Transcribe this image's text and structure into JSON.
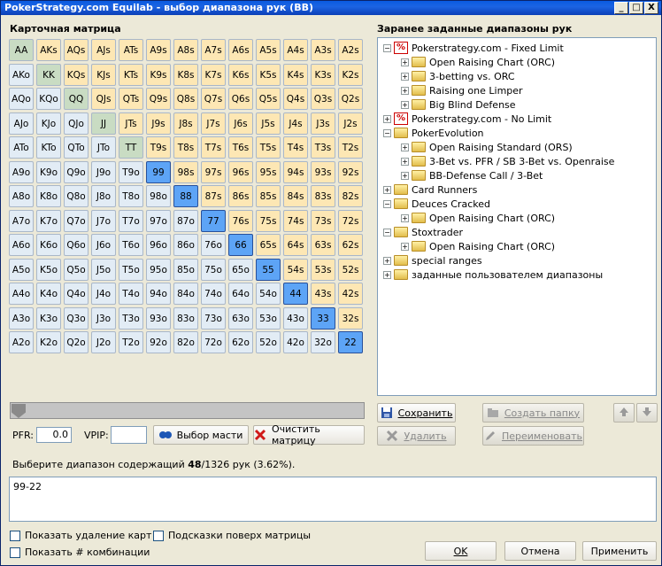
{
  "window": {
    "title": "PokerStrategy.com Equilab - выбор диапазона рук (BB)",
    "minimize": "_",
    "maximize": "□",
    "close": "X"
  },
  "matrix": {
    "title": "Карточная матрица",
    "rows": [
      [
        "AA",
        "AKs",
        "AQs",
        "AJs",
        "ATs",
        "A9s",
        "A8s",
        "A7s",
        "A6s",
        "A5s",
        "A4s",
        "A3s",
        "A2s"
      ],
      [
        "AKo",
        "KK",
        "KQs",
        "KJs",
        "KTs",
        "K9s",
        "K8s",
        "K7s",
        "K6s",
        "K5s",
        "K4s",
        "K3s",
        "K2s"
      ],
      [
        "AQo",
        "KQo",
        "QQ",
        "QJs",
        "QTs",
        "Q9s",
        "Q8s",
        "Q7s",
        "Q6s",
        "Q5s",
        "Q4s",
        "Q3s",
        "Q2s"
      ],
      [
        "AJo",
        "KJo",
        "QJo",
        "JJ",
        "JTs",
        "J9s",
        "J8s",
        "J7s",
        "J6s",
        "J5s",
        "J4s",
        "J3s",
        "J2s"
      ],
      [
        "ATo",
        "KTo",
        "QTo",
        "JTo",
        "TT",
        "T9s",
        "T8s",
        "T7s",
        "T6s",
        "T5s",
        "T4s",
        "T3s",
        "T2s"
      ],
      [
        "A9o",
        "K9o",
        "Q9o",
        "J9o",
        "T9o",
        "99",
        "98s",
        "97s",
        "96s",
        "95s",
        "94s",
        "93s",
        "92s"
      ],
      [
        "A8o",
        "K8o",
        "Q8o",
        "J8o",
        "T8o",
        "98o",
        "88",
        "87s",
        "86s",
        "85s",
        "84s",
        "83s",
        "82s"
      ],
      [
        "A7o",
        "K7o",
        "Q7o",
        "J7o",
        "T7o",
        "97o",
        "87o",
        "77",
        "76s",
        "75s",
        "74s",
        "73s",
        "72s"
      ],
      [
        "A6o",
        "K6o",
        "Q6o",
        "J6o",
        "T6o",
        "96o",
        "86o",
        "76o",
        "66",
        "65s",
        "64s",
        "63s",
        "62s"
      ],
      [
        "A5o",
        "K5o",
        "Q5o",
        "J5o",
        "T5o",
        "95o",
        "85o",
        "75o",
        "65o",
        "55",
        "54s",
        "53s",
        "52s"
      ],
      [
        "A4o",
        "K4o",
        "Q4o",
        "J4o",
        "T4o",
        "94o",
        "84o",
        "74o",
        "64o",
        "54o",
        "44",
        "43s",
        "42s"
      ],
      [
        "A3o",
        "K3o",
        "Q3o",
        "J3o",
        "T3o",
        "93o",
        "83o",
        "73o",
        "63o",
        "53o",
        "43o",
        "33",
        "32s"
      ],
      [
        "A2o",
        "K2o",
        "Q2o",
        "J2o",
        "T2o",
        "92o",
        "82o",
        "72o",
        "62o",
        "52o",
        "42o",
        "32o",
        "22"
      ]
    ],
    "selected": [
      "99",
      "88",
      "77",
      "66",
      "55",
      "44",
      "33",
      "22"
    ]
  },
  "controls": {
    "slider_value": 0,
    "pfr_label": "PFR:",
    "pfr_value": "0.0",
    "vpip_label": "VPIP:",
    "vpip_value": "",
    "suits_button": "Выбор масти",
    "clear_button": "Очистить матрицу"
  },
  "ranges": {
    "title": "Заранее заданные диапазоны рук",
    "tree": [
      {
        "level": 0,
        "expander": "−",
        "icon": "pct",
        "label": "Pokerstrategy.com - Fixed Limit"
      },
      {
        "level": 1,
        "expander": "+",
        "icon": "folder",
        "label": "Open Raising Chart (ORC)"
      },
      {
        "level": 1,
        "expander": "+",
        "icon": "folder",
        "label": "3-betting vs. ORC"
      },
      {
        "level": 1,
        "expander": "+",
        "icon": "folder",
        "label": "Raising one Limper"
      },
      {
        "level": 1,
        "expander": "+",
        "icon": "folder",
        "label": "Big Blind Defense"
      },
      {
        "level": 0,
        "expander": "+",
        "icon": "pct",
        "label": "Pokerstrategy.com - No Limit"
      },
      {
        "level": 0,
        "expander": "−",
        "icon": "folder",
        "label": "PokerEvolution"
      },
      {
        "level": 1,
        "expander": "+",
        "icon": "folder",
        "label": "Open Raising Standard (ORS)"
      },
      {
        "level": 1,
        "expander": "+",
        "icon": "folder",
        "label": "3-Bet vs. PFR / SB 3-Bet vs. Openraise"
      },
      {
        "level": 1,
        "expander": "+",
        "icon": "folder",
        "label": "BB-Defense Call / 3-Bet"
      },
      {
        "level": 0,
        "expander": "+",
        "icon": "folder",
        "label": "Card Runners"
      },
      {
        "level": 0,
        "expander": "−",
        "icon": "folder",
        "label": "Deuces Cracked"
      },
      {
        "level": 1,
        "expander": "+",
        "icon": "folder",
        "label": "Open Raising Chart (ORC)"
      },
      {
        "level": 0,
        "expander": "−",
        "icon": "folder",
        "label": "Stoxtrader"
      },
      {
        "level": 1,
        "expander": "+",
        "icon": "folder",
        "label": "Open Raising Chart (ORC)"
      },
      {
        "level": 0,
        "expander": "+",
        "icon": "folder",
        "label": "special ranges"
      },
      {
        "level": 0,
        "expander": "+",
        "icon": "userfolder",
        "label": "заданные пользователем диапазоны"
      }
    ],
    "save": "Сохранить",
    "delete": "Удалить",
    "create_folder": "Создать папку",
    "rename": "Переименовать"
  },
  "status": {
    "prefix": "Выберите диапазон содержащий ",
    "count": "48",
    "suffix": "/1326 рук (3.62%)."
  },
  "range_text": "99-22",
  "options": {
    "show_card_removal": "Показать удаление карт",
    "show_combos": "Показать # комбинации",
    "tooltips": "Подсказки поверх матрицы"
  },
  "footer": {
    "ok": "OK",
    "cancel": "Отмена",
    "apply": "Применить"
  },
  "colors": {
    "pair": "#c9dcc3",
    "suited": "#fde7b4",
    "offsuit": "#e2ecf5",
    "selected": "#5da4f6"
  }
}
